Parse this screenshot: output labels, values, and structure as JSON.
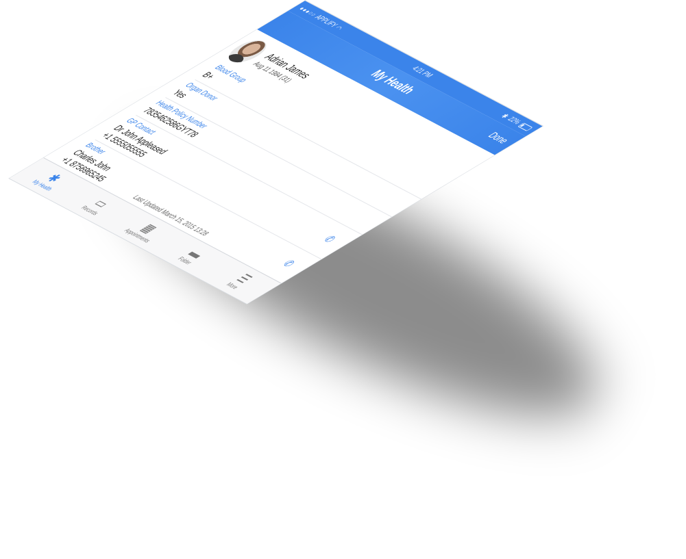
{
  "status": {
    "carrier": "APPLIFY",
    "time": "4:21 PM",
    "battery": "22%",
    "battery_level": 0.22
  },
  "nav": {
    "title": "My Health",
    "done_label": "Done"
  },
  "profile": {
    "name": "Adrian James",
    "dob": "Aug 11 1984 (31)"
  },
  "fields": [
    {
      "label": "Blood Group",
      "value": "B+"
    },
    {
      "label": "Organ Donor",
      "value": "Yes"
    },
    {
      "label": "Health Policy Number",
      "value": "7835462586GYT78"
    },
    {
      "label": "GP Contact",
      "value": "Dr John Appleased",
      "value2": "+1 5555055555"
    },
    {
      "label": "Brother",
      "value": "Charles John",
      "value2": "+1 8756965245"
    }
  ],
  "last_updated": "Last Updated March 15, 2015 13:28",
  "tabs": [
    {
      "label": "My Health",
      "icon": "asterisk-icon"
    },
    {
      "label": "Records",
      "icon": "image-icon"
    },
    {
      "label": "Appointments",
      "icon": "calendar-icon"
    },
    {
      "label": "Folder",
      "icon": "folder-icon"
    },
    {
      "label": "More",
      "icon": "menu-icon"
    }
  ],
  "colors": {
    "accent": "#3b84ea"
  }
}
